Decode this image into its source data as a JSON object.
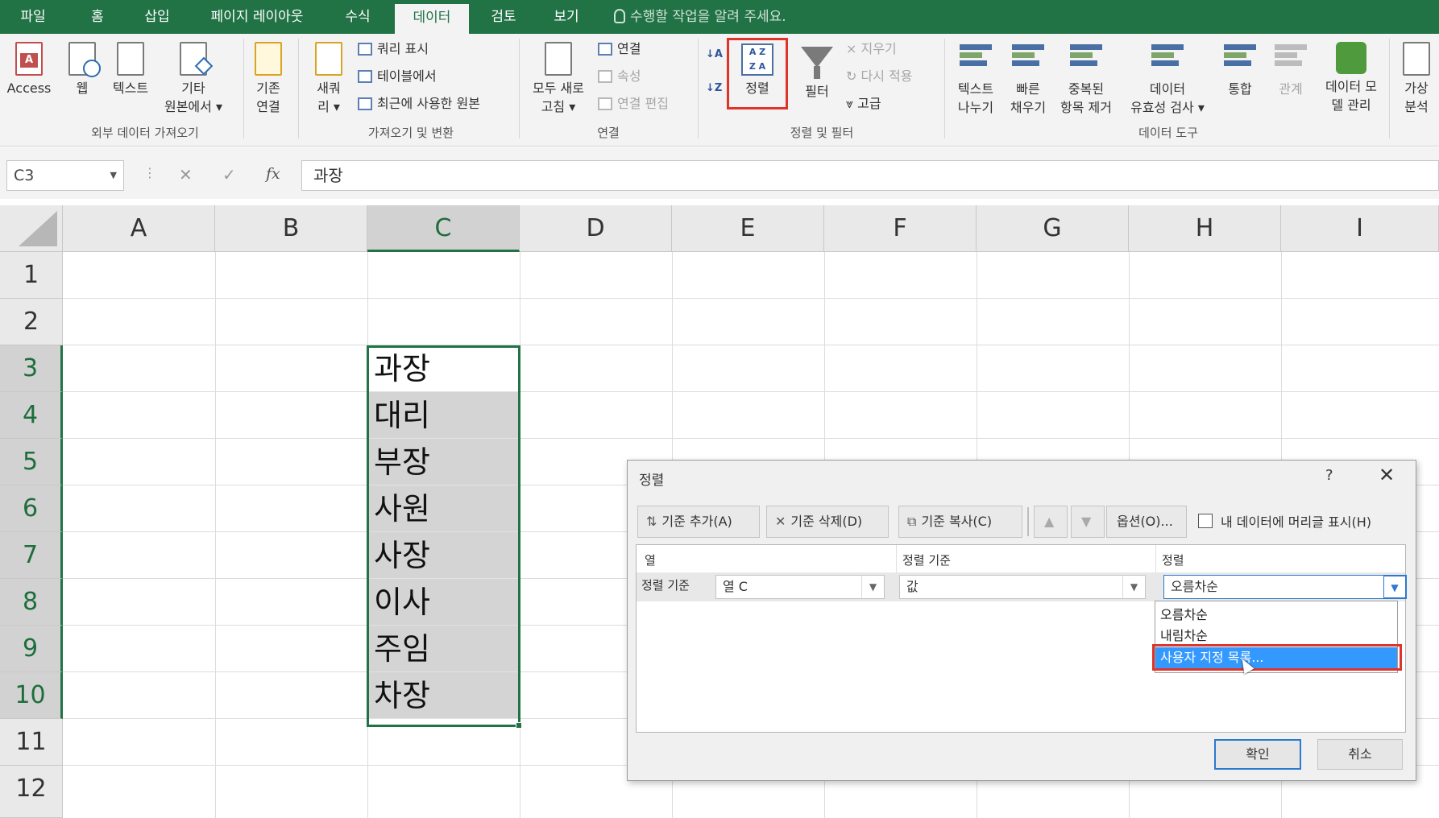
{
  "tabs": [
    {
      "label": "파일"
    },
    {
      "label": "홈"
    },
    {
      "label": "삽입"
    },
    {
      "label": "페이지 레이아웃"
    },
    {
      "label": "수식"
    },
    {
      "label": "데이터",
      "active": true
    },
    {
      "label": "검토"
    },
    {
      "label": "보기"
    }
  ],
  "tell_me": "수행할 작업을 알려 주세요.",
  "ribbon": {
    "external": {
      "access": "Access",
      "web": "웹",
      "text": "텍스트",
      "other_1": "기타",
      "other_2": "원본에서",
      "group": "외부 데이터 가져오기"
    },
    "existing": {
      "line1": "기존",
      "line2": "연결"
    },
    "transform": {
      "new_query_1": "새쿼",
      "new_query_2": "리",
      "show_queries": "쿼리 표시",
      "from_table": "테이블에서",
      "recent": "최근에 사용한 원본",
      "group": "가져오기 및 변환"
    },
    "connections": {
      "refresh_1": "모두 새로",
      "refresh_2": "고침",
      "connections": "연결",
      "properties": "속성",
      "edit_links": "연결 편집",
      "group": "연결"
    },
    "sortfilter": {
      "sort": "정렬",
      "filter": "필터",
      "clear": "지우기",
      "reapply": "다시 적용",
      "advanced": "고급",
      "group": "정렬 및 필터"
    },
    "datatools": {
      "text_to_cols_1": "텍스트",
      "text_to_cols_2": "나누기",
      "flash_1": "빠른",
      "flash_2": "채우기",
      "dup_1": "중복된",
      "dup_2": "항목 제거",
      "valid_1": "데이터",
      "valid_2": "유효성 검사",
      "consolidate": "통합",
      "relations": "관계",
      "model_1": "데이터 모",
      "model_2": "델 관리",
      "group": "데이터 도구"
    },
    "forecast": {
      "whatif_1": "가상",
      "whatif_2": "분석"
    }
  },
  "formula_bar": {
    "name_box": "C3",
    "fx": "fx",
    "value": "과장"
  },
  "columns": [
    "A",
    "B",
    "C",
    "D",
    "E",
    "F",
    "G",
    "H",
    "I"
  ],
  "rows": [
    "1",
    "2",
    "3",
    "4",
    "5",
    "6",
    "7",
    "8",
    "9",
    "10",
    "11",
    "12"
  ],
  "cells": {
    "C3": "과장",
    "C4": "대리",
    "C5": "부장",
    "C6": "사원",
    "C7": "사장",
    "C8": "이사",
    "C9": "주임",
    "C10": "차장"
  },
  "dialog": {
    "title": "정렬",
    "help": "?",
    "close": "✕",
    "add_level": "기준 추가(A)",
    "delete_level": "기준 삭제(D)",
    "copy_level": "기준 복사(C)",
    "options": "옵션(O)...",
    "has_headers": "내 데이터에 머리글 표시(H)",
    "col_header": "열",
    "sorton_header": "정렬 기준",
    "order_header": "정렬",
    "row_label": "정렬 기준",
    "column_value": "열 C",
    "sorton_value": "값",
    "order_value": "오름차순",
    "order_options": [
      "오름차순",
      "내림차순",
      "사용자 지정 목록..."
    ],
    "ok": "확인",
    "cancel": "취소"
  },
  "colors": {
    "accent": "#217346",
    "highlight": "#e0342a",
    "list_selection": "#3399ff"
  }
}
